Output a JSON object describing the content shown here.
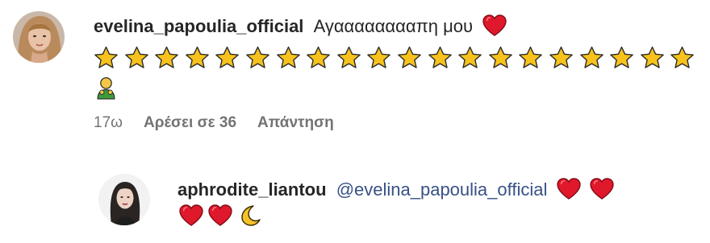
{
  "comment": {
    "username": "evelina_papoulia_official",
    "text": "Αγααααααααπη μου",
    "trailing_emoji": "heart-icon",
    "stars_count": 20,
    "extra_emoji": "person-with-flowers-icon",
    "time": "17ω",
    "likes_label": "Αρέσει σε 36",
    "reply_label": "Απάντηση"
  },
  "reply": {
    "username": "aphrodite_liantou",
    "mention": "@evelina_papoulia_official",
    "emojis_line1": [
      "heart-icon",
      "heart-icon"
    ],
    "emojis_line2": [
      "heart-icon",
      "heart-icon",
      "crescent-moon-icon"
    ]
  },
  "colors": {
    "text": "#262626",
    "meta": "#737373",
    "mention": "#385185",
    "heart": "#e0182b",
    "star": "#f7c21b"
  }
}
